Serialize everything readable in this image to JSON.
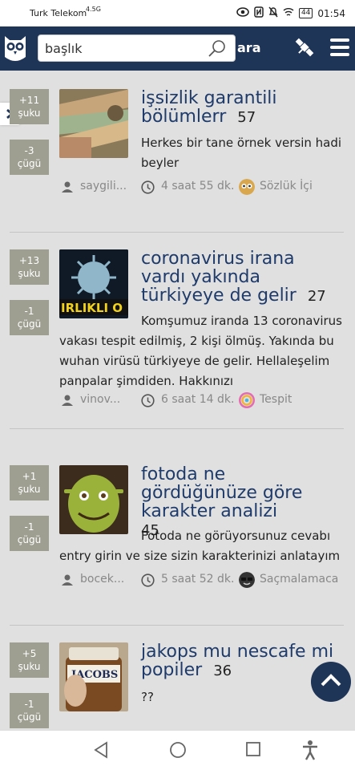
{
  "status_bar": {
    "carrier": "Turk Telekom",
    "network": "4.5G",
    "battery": "44",
    "time": "01:54"
  },
  "header": {
    "search_value": "başlık",
    "search_button_label": "ara"
  },
  "accent_color": "#1e3558",
  "entries": [
    {
      "up_votes": "+11",
      "up_label": "şuku",
      "down_votes": "-3",
      "down_label": "çügü",
      "title": "işsizlik garantili bölümlerr",
      "comment_count": "57",
      "body": "Herkes bir tane örnek versin hadi beyler",
      "author": "saygili...",
      "time_ago": "4 saat 55 dk.",
      "channel": "Sözlük İçi",
      "thumbnail": "money-photo"
    },
    {
      "up_votes": "+13",
      "up_label": "şuku",
      "down_votes": "-1",
      "down_label": "çügü",
      "title": "coronavirus irana vardı yakında türkiyeye de gelir",
      "comment_count": "27",
      "body": "Komşumuz iranda 13 coronavirus vakası tespit edilmiş, 2 kişi ölmüş. Yakında bu wuhan virüsü türkiyeye de gelir. Hellaleşelim panpalar şimdiden. Hakkınızı",
      "author": "vinov...",
      "time_ago": "6 saat 14 dk.",
      "channel": "Tespit",
      "thumbnail": "virus-image",
      "thumbnail_text": "IRLIKLI O"
    },
    {
      "up_votes": "+1",
      "up_label": "şuku",
      "down_votes": "-1",
      "down_label": "çügü",
      "title": "fotoda ne gördüğünüze göre karakter analizi",
      "comment_count": "45",
      "body": "Fotoda ne görüyorsunuz cevabı entry girin ve size sizin karakterinizi anlatayım",
      "author": "bocek...",
      "time_ago": "5 saat 52 dk.",
      "channel": "Saçmalamaca",
      "thumbnail": "shrek-image"
    },
    {
      "up_votes": "+5",
      "up_label": "şuku",
      "down_votes": "-1",
      "down_label": "çügü",
      "title": "jakops mu nescafe mi popiler",
      "comment_count": "36",
      "body": "??",
      "thumbnail": "coffee-jar-photo",
      "thumbnail_text": "JACOBS"
    }
  ]
}
